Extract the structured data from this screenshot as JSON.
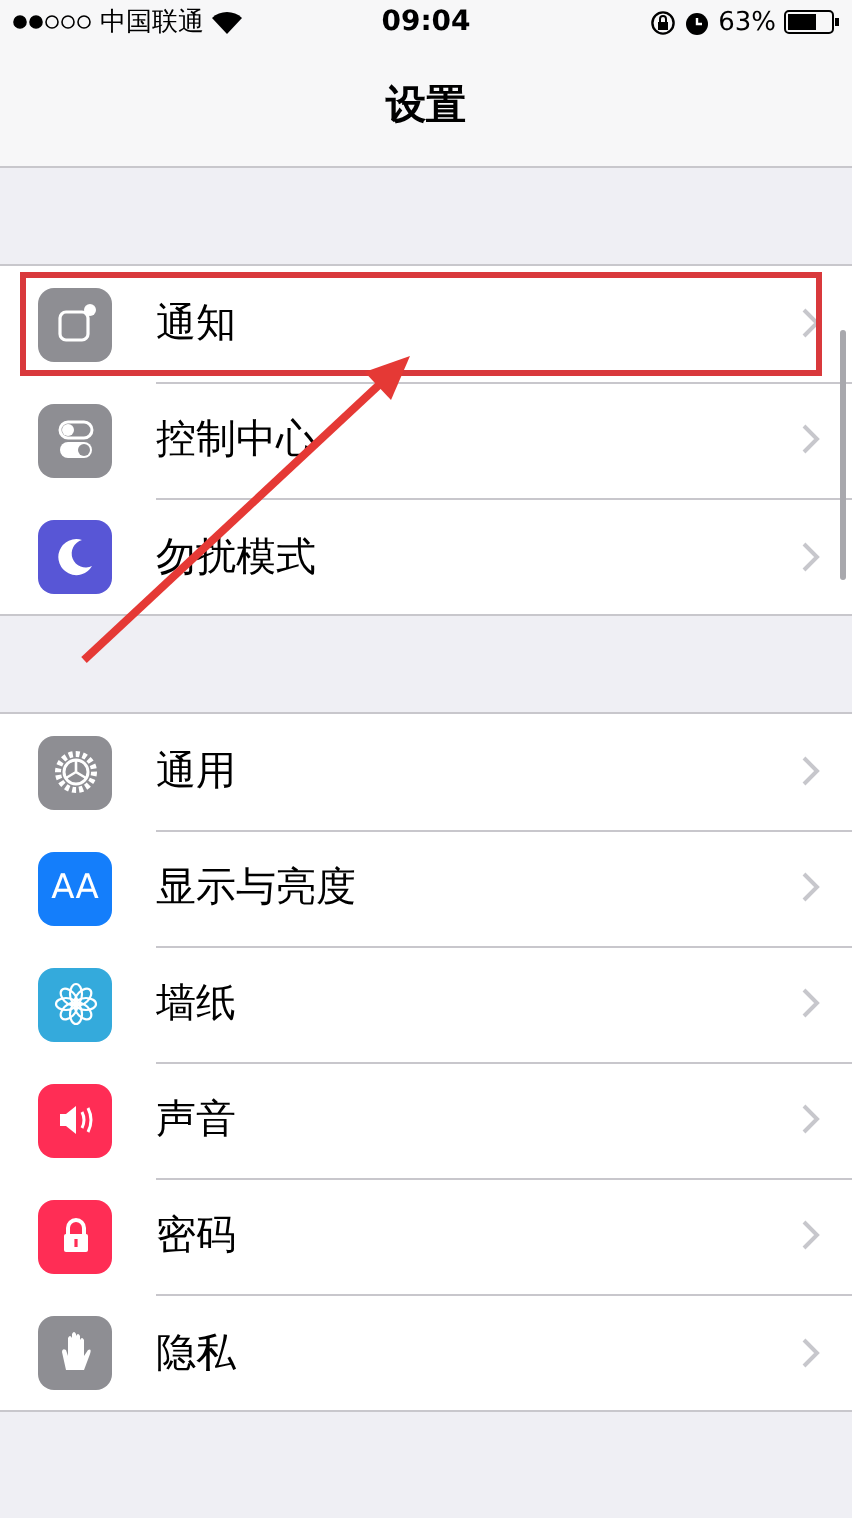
{
  "status_bar": {
    "carrier": "中国联通",
    "time": "09:04",
    "battery": "63%"
  },
  "nav_bar": {
    "title": "设置"
  },
  "groups": [
    {
      "items": [
        {
          "label": "通知",
          "kind": "notifications",
          "color": "#8e8e93",
          "highlighted": true
        },
        {
          "label": "控制中心",
          "kind": "control",
          "color": "#8e8e93",
          "highlighted": false
        },
        {
          "label": "勿扰模式",
          "kind": "moon",
          "color": "#5856d6",
          "highlighted": false
        }
      ]
    },
    {
      "items": [
        {
          "label": "通用",
          "kind": "gear",
          "color": "#8e8e93",
          "highlighted": false
        },
        {
          "label": "显示与亮度",
          "kind": "display",
          "color": "#147efb",
          "highlighted": false,
          "icon_text": "AA"
        },
        {
          "label": "墙纸",
          "kind": "flower",
          "color": "#34aadc",
          "highlighted": false
        },
        {
          "label": "声音",
          "kind": "sound",
          "color": "#ff2d55",
          "highlighted": false
        },
        {
          "label": "密码",
          "kind": "lock",
          "color": "#ff2d55",
          "highlighted": false
        },
        {
          "label": "隐私",
          "kind": "hand",
          "color": "#8e8e93",
          "highlighted": false
        }
      ]
    }
  ],
  "annotations": [
    {
      "kind": "arrow"
    }
  ]
}
